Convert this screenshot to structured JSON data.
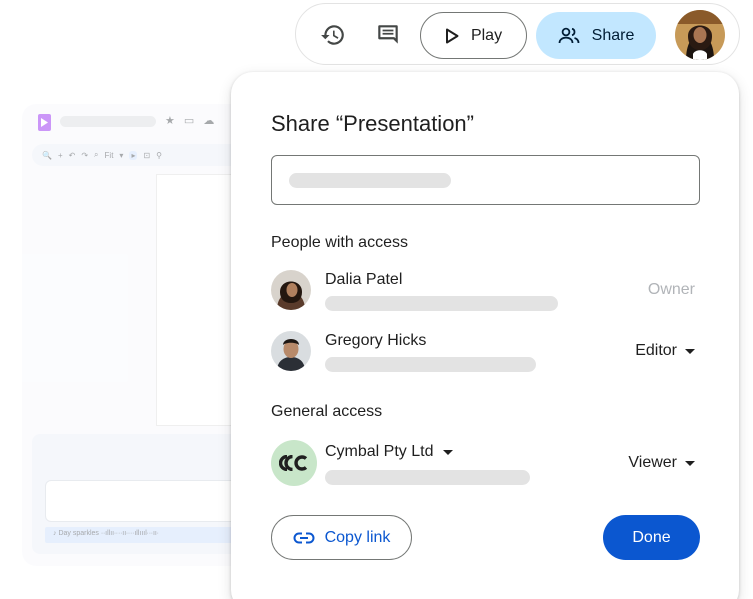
{
  "background_editor": {
    "title_icons": "★ ▭ ☁",
    "toolbar_items": [
      "🔍",
      "+",
      "↶",
      "↷",
      "⌕",
      "Fit",
      "▾",
      "▸",
      "⊡",
      "⚲"
    ],
    "audio_label": "Day sparkles",
    "audio_wave": "·∙ıllıı∙∙·∙ıı∙∙·∙ıllıııl∙·∙ıı∙"
  },
  "topbar": {
    "history_icon": "history-icon",
    "comment_icon": "comment-icon",
    "play_label": "Play",
    "share_label": "Share"
  },
  "dialog": {
    "title": "Share “Presentation”",
    "people_label": "People with access",
    "people": [
      {
        "name": "Dalia Patel",
        "role": "Owner"
      },
      {
        "name": "Gregory Hicks",
        "role": "Editor"
      }
    ],
    "general_label": "General access",
    "org_name": "Cymbal Pty Ltd",
    "org_role": "Viewer",
    "copy_label": "Copy link",
    "done_label": "Done"
  },
  "colors": {
    "primary": "#0b57d0",
    "share_chip": "#c2e7ff",
    "org_avatar": "#c8e6c9",
    "skeleton": "#e3e3e3"
  }
}
